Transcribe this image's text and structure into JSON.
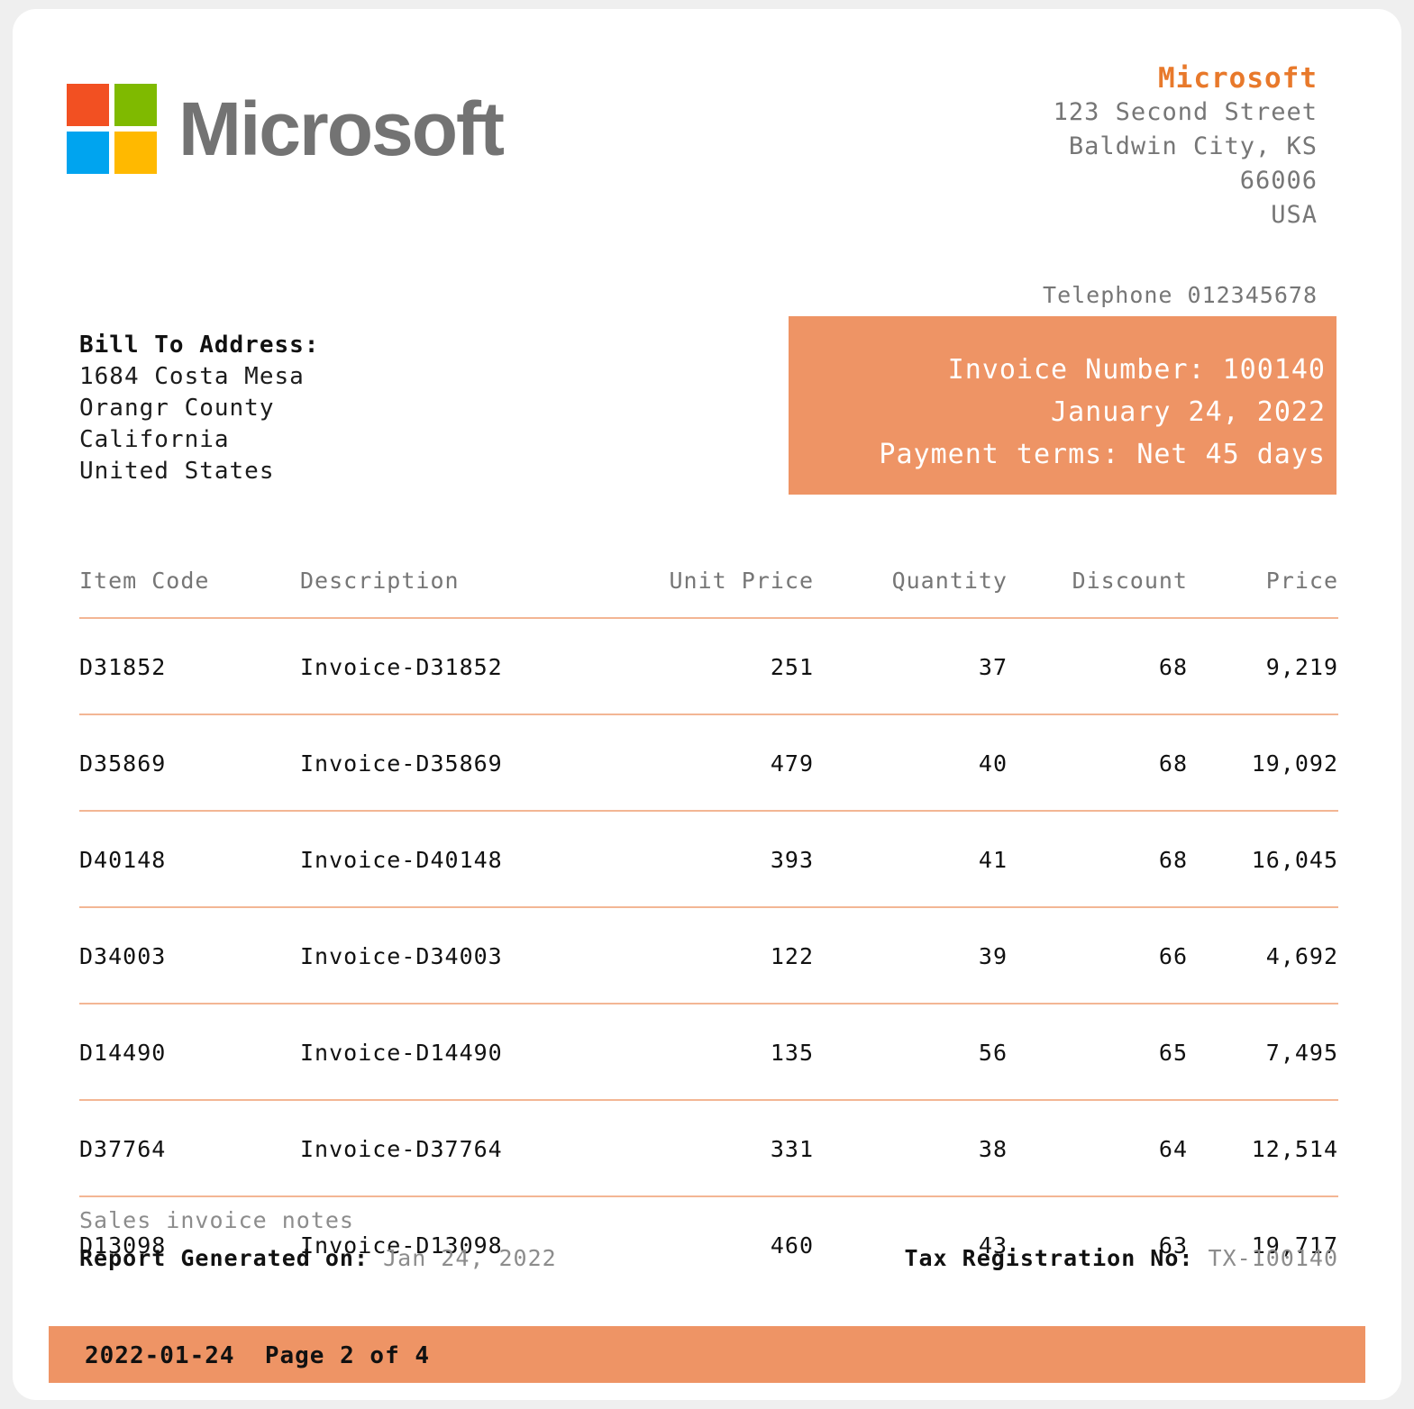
{
  "document": {
    "type": "invoice",
    "brand_color": "#e8792b",
    "accent_color": "#ee9465",
    "rule_color": "#f3b694"
  },
  "header": {
    "logo_word": "Microsoft",
    "logo_squares": [
      {
        "name": "red",
        "color": "#f25022"
      },
      {
        "name": "green",
        "color": "#7fba00"
      },
      {
        "name": "blue",
        "color": "#00a4ef"
      },
      {
        "name": "yellow",
        "color": "#ffb900"
      }
    ],
    "company_name": "Microsoft",
    "address_line_1": "123 Second Street",
    "address_line_2": "Baldwin City, KS",
    "address_line_3": "66006",
    "address_line_4": "USA",
    "telephone": "Telephone 012345678"
  },
  "bill_to": {
    "title": "Bill To Address:",
    "line_1": "1684 Costa Mesa",
    "line_2": "Orangr County",
    "line_3": "California",
    "line_4": "United States"
  },
  "invoice_meta": {
    "invoice_number_line": "Invoice Number: 100140",
    "date_line": "January 24, 2022",
    "payment_terms_line": "Payment terms: Net 45 days"
  },
  "table": {
    "columns": [
      "Item Code",
      "Description",
      "Unit Price",
      "Quantity",
      "Discount",
      "Price"
    ],
    "rows": [
      {
        "item_code": "D31852",
        "description": "Invoice-D31852",
        "unit_price": "251",
        "quantity": "37",
        "discount": "68",
        "price": "9,219"
      },
      {
        "item_code": "D35869",
        "description": "Invoice-D35869",
        "unit_price": "479",
        "quantity": "40",
        "discount": "68",
        "price": "19,092"
      },
      {
        "item_code": "D40148",
        "description": "Invoice-D40148",
        "unit_price": "393",
        "quantity": "41",
        "discount": "68",
        "price": "16,045"
      },
      {
        "item_code": "D34003",
        "description": "Invoice-D34003",
        "unit_price": "122",
        "quantity": "39",
        "discount": "66",
        "price": "4,692"
      },
      {
        "item_code": "D14490",
        "description": "Invoice-D14490",
        "unit_price": "135",
        "quantity": "56",
        "discount": "65",
        "price": "7,495"
      },
      {
        "item_code": "D37764",
        "description": "Invoice-D37764",
        "unit_price": "331",
        "quantity": "38",
        "discount": "64",
        "price": "12,514"
      },
      {
        "item_code": "D13098",
        "description": "Invoice-D13098",
        "unit_price": "460",
        "quantity": "43",
        "discount": "63",
        "price": "19,717"
      }
    ]
  },
  "notes": {
    "title": "Sales invoice notes",
    "report_generated_label": "Report Generated on:",
    "report_generated_value": "Jan 24, 2022",
    "tax_registration_label": "Tax Registration No:",
    "tax_registration_value": "TX-100140"
  },
  "footer": {
    "text": "2022-01-24  Page 2 of 4"
  }
}
